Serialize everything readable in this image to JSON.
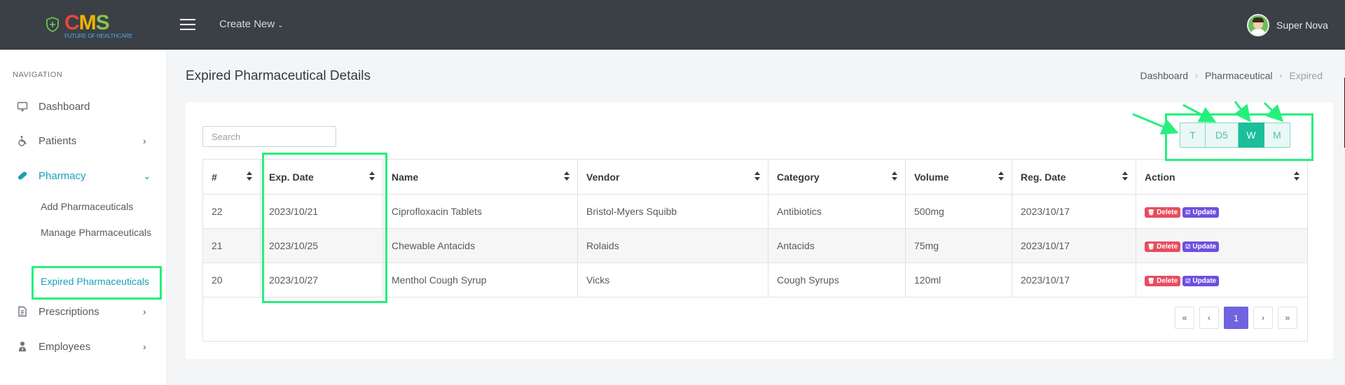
{
  "topbar": {
    "logo_text": "CMS",
    "logo_tagline": "FUTURE OF HEALTHCARE",
    "create_new_label": "Create New",
    "user_name": "Super Nova"
  },
  "sidebar": {
    "nav_title": "NAVIGATION",
    "items": [
      {
        "label": "Dashboard",
        "icon": "monitor-icon"
      },
      {
        "label": "Patients",
        "icon": "wheelchair-icon"
      },
      {
        "label": "Pharmacy",
        "icon": "pill-icon"
      },
      {
        "label": "Prescriptions",
        "icon": "document-icon"
      },
      {
        "label": "Employees",
        "icon": "user-tie-icon"
      }
    ],
    "pharmacy_sub": [
      {
        "label": "Add Pharmaceuticals"
      },
      {
        "label": "Manage Pharmaceuticals"
      },
      {
        "label": "Expired Pharmaceuticals"
      }
    ]
  },
  "main": {
    "title": "Expired Pharmaceutical Details",
    "breadcrumb": [
      "Dashboard",
      "Pharmaceutical",
      "Expired"
    ],
    "search_placeholder": "Search",
    "filters": [
      "T",
      "D5",
      "W",
      "M"
    ],
    "active_filter": "W",
    "table": {
      "columns": [
        "#",
        "Exp. Date",
        "Name",
        "Vendor",
        "Category",
        "Volume",
        "Reg. Date",
        "Action"
      ],
      "rows": [
        {
          "id": "22",
          "exp_date": "2023/10/21",
          "name": "Ciprofloxacin Tablets",
          "vendor": "Bristol-Myers Squibb",
          "category": "Antibiotics",
          "volume": "500mg",
          "reg_date": "2023/10/17"
        },
        {
          "id": "21",
          "exp_date": "2023/10/25",
          "name": "Chewable Antacids",
          "vendor": "Rolaids",
          "category": "Antacids",
          "volume": "75mg",
          "reg_date": "2023/10/17"
        },
        {
          "id": "20",
          "exp_date": "2023/10/27",
          "name": "Menthol Cough Syrup",
          "vendor": "Vicks",
          "category": "Cough Syrups",
          "volume": "120ml",
          "reg_date": "2023/10/17"
        }
      ],
      "delete_label": "Delete",
      "update_label": "Update"
    },
    "pagination": {
      "first": "«",
      "prev": "‹",
      "current": "1",
      "next": "›",
      "last": "»"
    }
  },
  "colors": {
    "topbar_bg": "#3a4046",
    "accent_teal": "#17a2b8",
    "filter_active": "#1bbf9a",
    "delete": "#e84c5f",
    "update": "#6f4fe0",
    "page_active": "#6f63e0",
    "annotation": "#25f07c"
  }
}
